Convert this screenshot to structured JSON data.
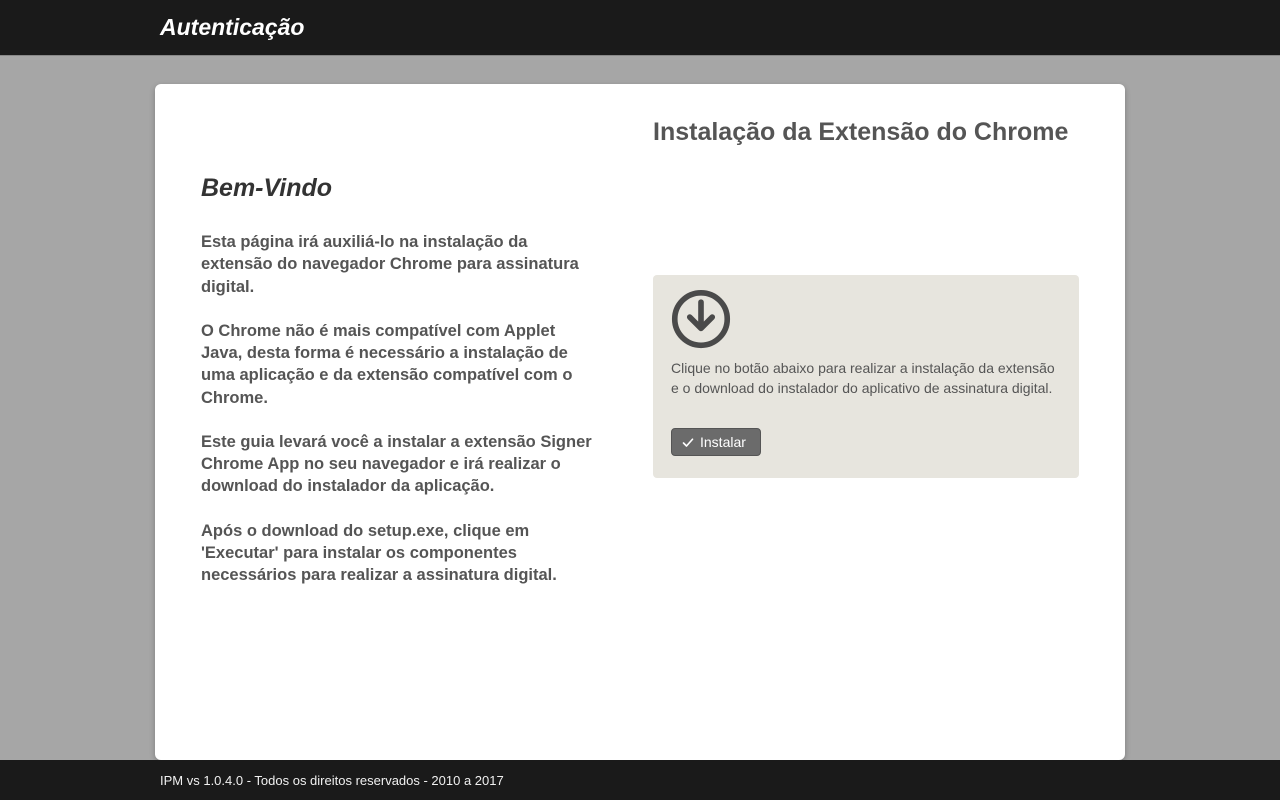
{
  "header": {
    "title": "Autenticação"
  },
  "welcome": {
    "heading": "Bem-Vindo",
    "p1": "Esta página irá auxiliá-lo na instalação da extensão do navegador Chrome para assinatura digital.",
    "p2": "O Chrome não é mais compatível com Applet Java, desta forma é necessário a instalação de uma aplicação e da extensão compatível com o Chrome.",
    "p3": "Este guia levará você a instalar a extensão Signer Chrome App no seu navegador e irá realizar o download do instalador da aplicação.",
    "p4": "Após o download do setup.exe, clique em 'Executar' para instalar os componentes necessários para realizar a assinatura digital."
  },
  "right": {
    "title": "Instalação da Extensão do Chrome",
    "box_text": "Clique no botão abaixo para realizar a instalação da extensão e o download do instalador do aplicativo de assinatura digital.",
    "install_label": "Instalar"
  },
  "footer": {
    "text": "IPM vs 1.0.4.0 - Todos os direitos reservados - 2010 a 2017"
  }
}
